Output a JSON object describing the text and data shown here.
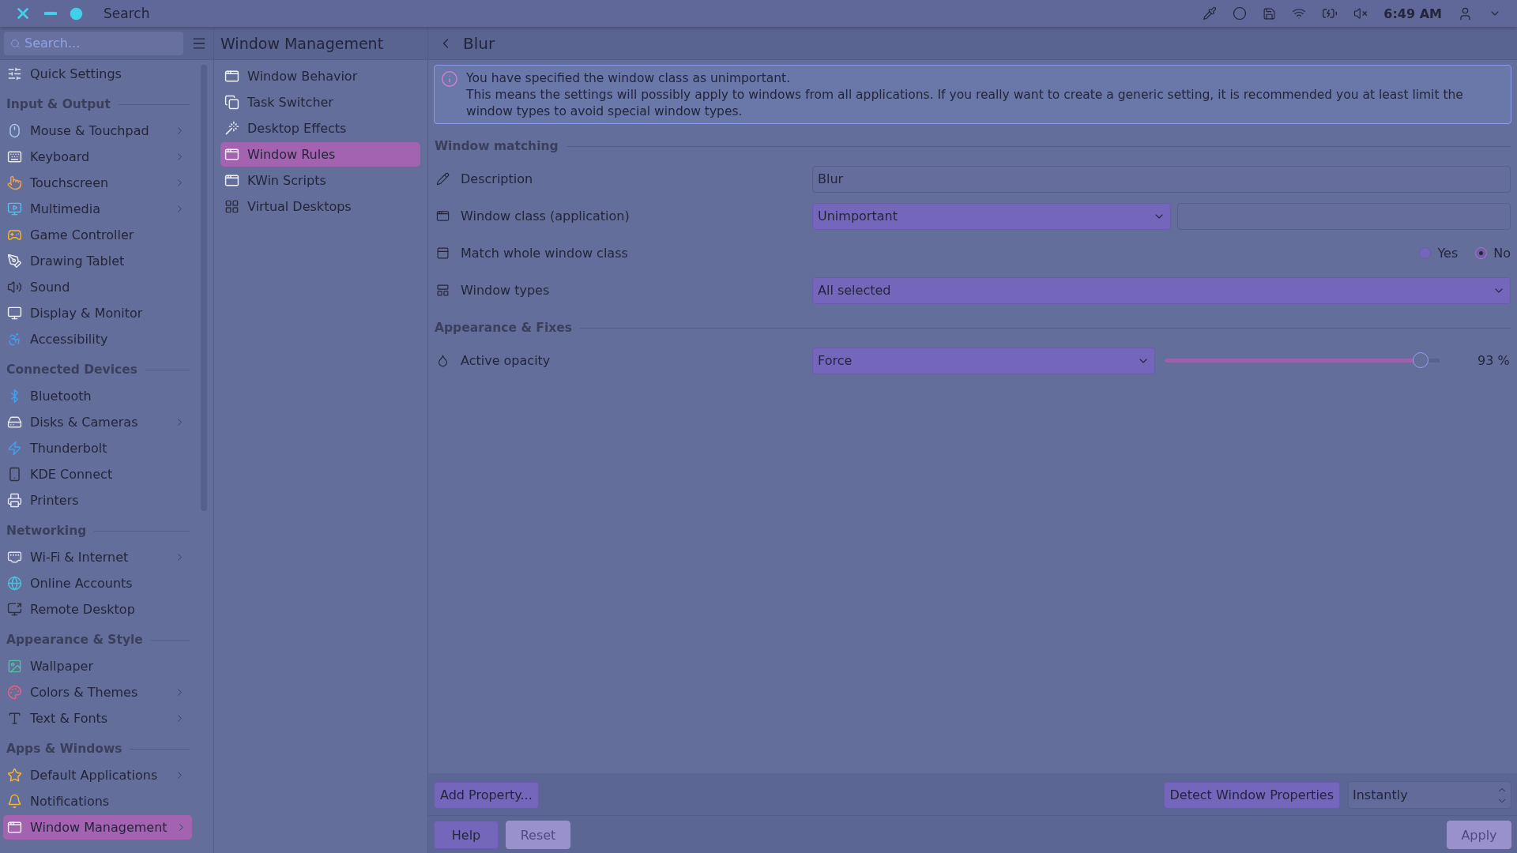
{
  "top_bar": {
    "title": "Search",
    "clock": "6:49 AM"
  },
  "sidebar": {
    "search": {
      "placeholder": "Search..."
    },
    "sections": [
      {
        "items": [
          {
            "label": "Quick Settings",
            "has_arrow": false,
            "selected": false
          }
        ]
      },
      {
        "heading": "Input & Output",
        "items": [
          {
            "label": "Mouse & Touchpad",
            "has_arrow": true,
            "selected": false
          },
          {
            "label": "Keyboard",
            "has_arrow": true,
            "selected": false
          },
          {
            "label": "Touchscreen",
            "has_arrow": true,
            "selected": false
          },
          {
            "label": "Multimedia",
            "has_arrow": true,
            "selected": false
          },
          {
            "label": "Game Controller",
            "has_arrow": false,
            "selected": false
          },
          {
            "label": "Drawing Tablet",
            "has_arrow": false,
            "selected": false
          },
          {
            "label": "Sound",
            "has_arrow": false,
            "selected": false
          },
          {
            "label": "Display & Monitor",
            "has_arrow": false,
            "selected": false
          },
          {
            "label": "Accessibility",
            "has_arrow": false,
            "selected": false
          }
        ]
      },
      {
        "heading": "Connected Devices",
        "items": [
          {
            "label": "Bluetooth",
            "has_arrow": false,
            "selected": false
          },
          {
            "label": "Disks & Cameras",
            "has_arrow": true,
            "selected": false
          },
          {
            "label": "Thunderbolt",
            "has_arrow": false,
            "selected": false
          },
          {
            "label": "KDE Connect",
            "has_arrow": false,
            "selected": false
          },
          {
            "label": "Printers",
            "has_arrow": false,
            "selected": false
          }
        ]
      },
      {
        "heading": "Networking",
        "items": [
          {
            "label": "Wi-Fi & Internet",
            "has_arrow": true,
            "selected": false
          },
          {
            "label": "Online Accounts",
            "has_arrow": false,
            "selected": false
          },
          {
            "label": "Remote Desktop",
            "has_arrow": false,
            "selected": false
          }
        ]
      },
      {
        "heading": "Appearance & Style",
        "items": [
          {
            "label": "Wallpaper",
            "has_arrow": false,
            "selected": false
          },
          {
            "label": "Colors & Themes",
            "has_arrow": true,
            "selected": false
          },
          {
            "label": "Text & Fonts",
            "has_arrow": true,
            "selected": false
          }
        ]
      },
      {
        "heading": "Apps & Windows",
        "items": [
          {
            "label": "Default Applications",
            "has_arrow": true,
            "selected": false
          },
          {
            "label": "Notifications",
            "has_arrow": false,
            "selected": false
          },
          {
            "label": "Window Management",
            "has_arrow": true,
            "selected": true
          }
        ]
      }
    ]
  },
  "subcategory": {
    "title": "Window Management",
    "items": [
      {
        "label": "Window Behavior",
        "selected": false
      },
      {
        "label": "Task Switcher",
        "selected": false
      },
      {
        "label": "Desktop Effects",
        "selected": false
      },
      {
        "label": "Window Rules",
        "selected": true
      },
      {
        "label": "KWin Scripts",
        "selected": false
      },
      {
        "label": "Virtual Desktops",
        "selected": false
      }
    ]
  },
  "page": {
    "title": "Blur",
    "notice": {
      "headline": "You have specified the window class as unimportant.",
      "body": "This means the settings will possibly apply to windows from all applications. If you really want to create a generic setting, it is recommended you at least limit the window types to avoid special window types."
    },
    "sections": [
      {
        "heading": "Window matching",
        "rows": [
          {
            "kind": "text",
            "label": "Description",
            "value": "Blur"
          },
          {
            "kind": "combo_text",
            "label": "Window class (application)",
            "value": "Unimportant"
          },
          {
            "kind": "radio",
            "label": "Match whole window class",
            "options": [
              {
                "label": "Yes",
                "selected": false
              },
              {
                "label": "No",
                "selected": true
              }
            ]
          },
          {
            "kind": "combo",
            "label": "Window types",
            "value": "All selected"
          }
        ]
      },
      {
        "heading": "Appearance & Fixes",
        "rows": [
          {
            "kind": "combo_slider",
            "label": "Active opacity",
            "value": "Force",
            "level": 0.93,
            "reading": "93 %"
          }
        ]
      }
    ]
  },
  "footer": {
    "add_button": "Add Property...",
    "detect_button": "Detect Window Properties",
    "delay": "Instantly"
  },
  "buttons": [
    {
      "label": "Help",
      "disabled": false
    },
    {
      "label": "Reset",
      "disabled": true
    },
    {
      "label": "Apply",
      "disabled": true
    }
  ]
}
